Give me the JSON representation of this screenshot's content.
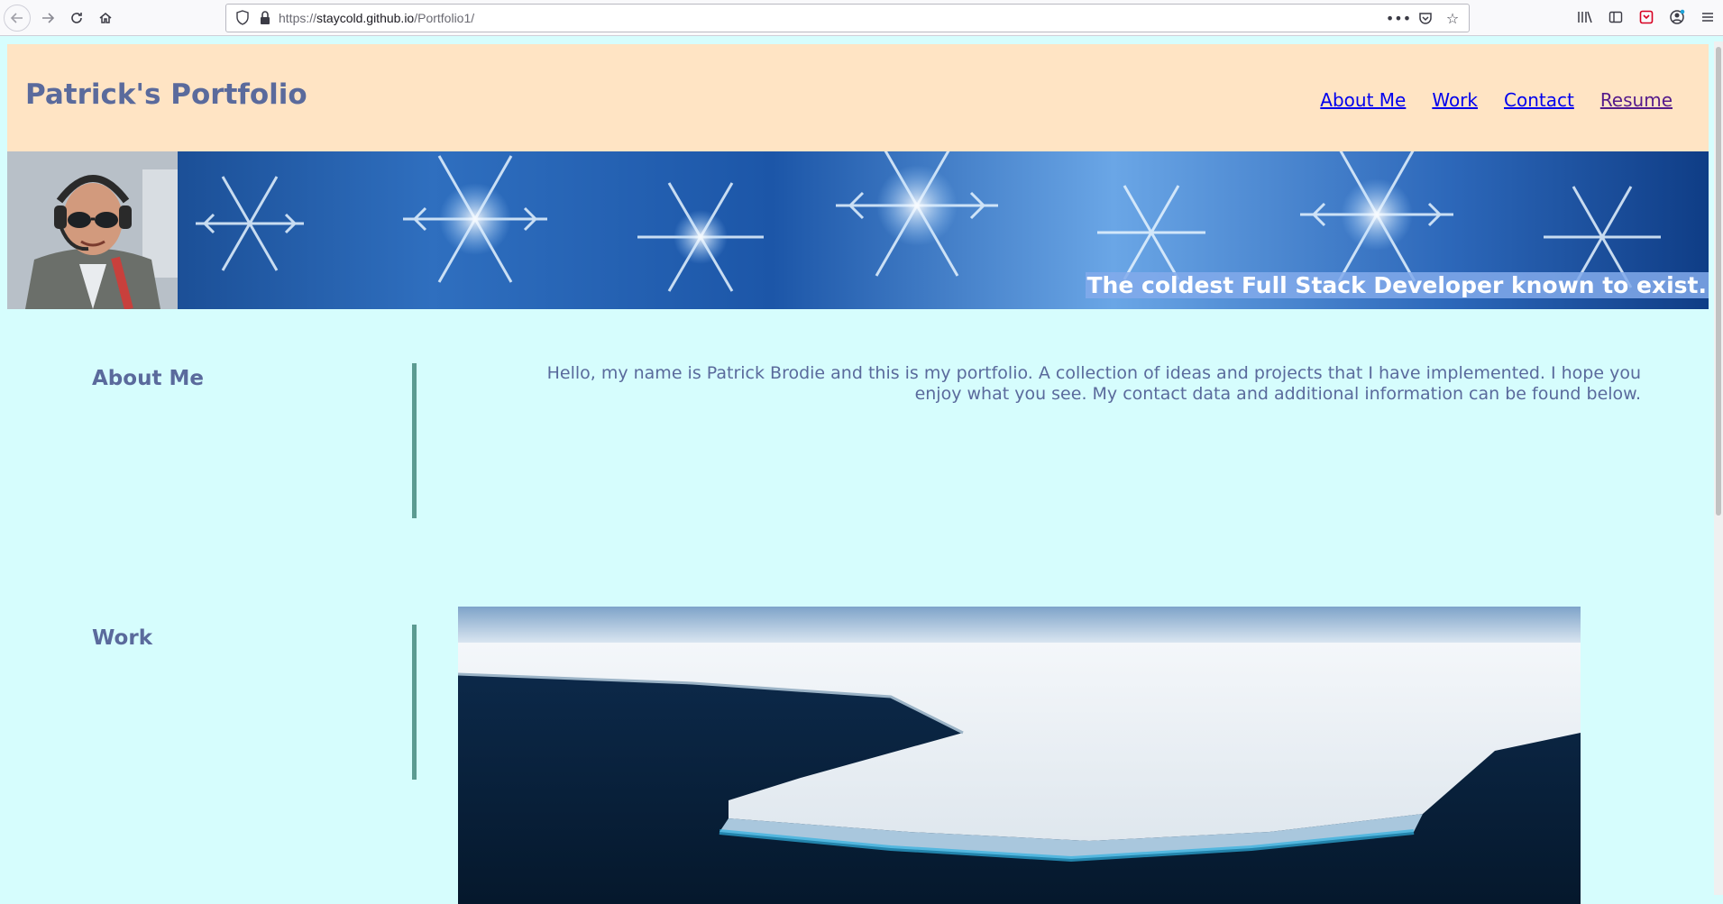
{
  "browser": {
    "url_prefix": "https://",
    "url_host": "staycold.github.io",
    "url_path": "/Portfolio1/"
  },
  "header": {
    "title": "Patrick's Portfolio",
    "nav": [
      {
        "label": "About Me"
      },
      {
        "label": "Work"
      },
      {
        "label": "Contact"
      },
      {
        "label": "Resume"
      }
    ]
  },
  "banner": {
    "tagline": "The coldest Full Stack Developer known to exist."
  },
  "about": {
    "heading": "About Me",
    "text": "Hello, my name is Patrick Brodie and this is my portfolio. A collection of ideas and projects that I have implemented. I hope you enjoy what you see. My contact data and additional information can be found below."
  },
  "work": {
    "heading": "Work"
  },
  "colors": {
    "page_bg": "#d6fdfd",
    "header_bg": "#ffe4c4",
    "heading": "#5a6a9c",
    "link": "#0000ee",
    "link_visited": "#551a8b",
    "divider": "#5b9b91"
  },
  "icons": [
    "back-arrow-icon",
    "forward-arrow-icon",
    "reload-icon",
    "home-icon",
    "shield-icon",
    "lock-icon",
    "more-icon",
    "pocket-icon",
    "bookmark-star-icon",
    "library-icon",
    "sidebar-icon",
    "extension-icon",
    "account-icon",
    "menu-icon"
  ]
}
